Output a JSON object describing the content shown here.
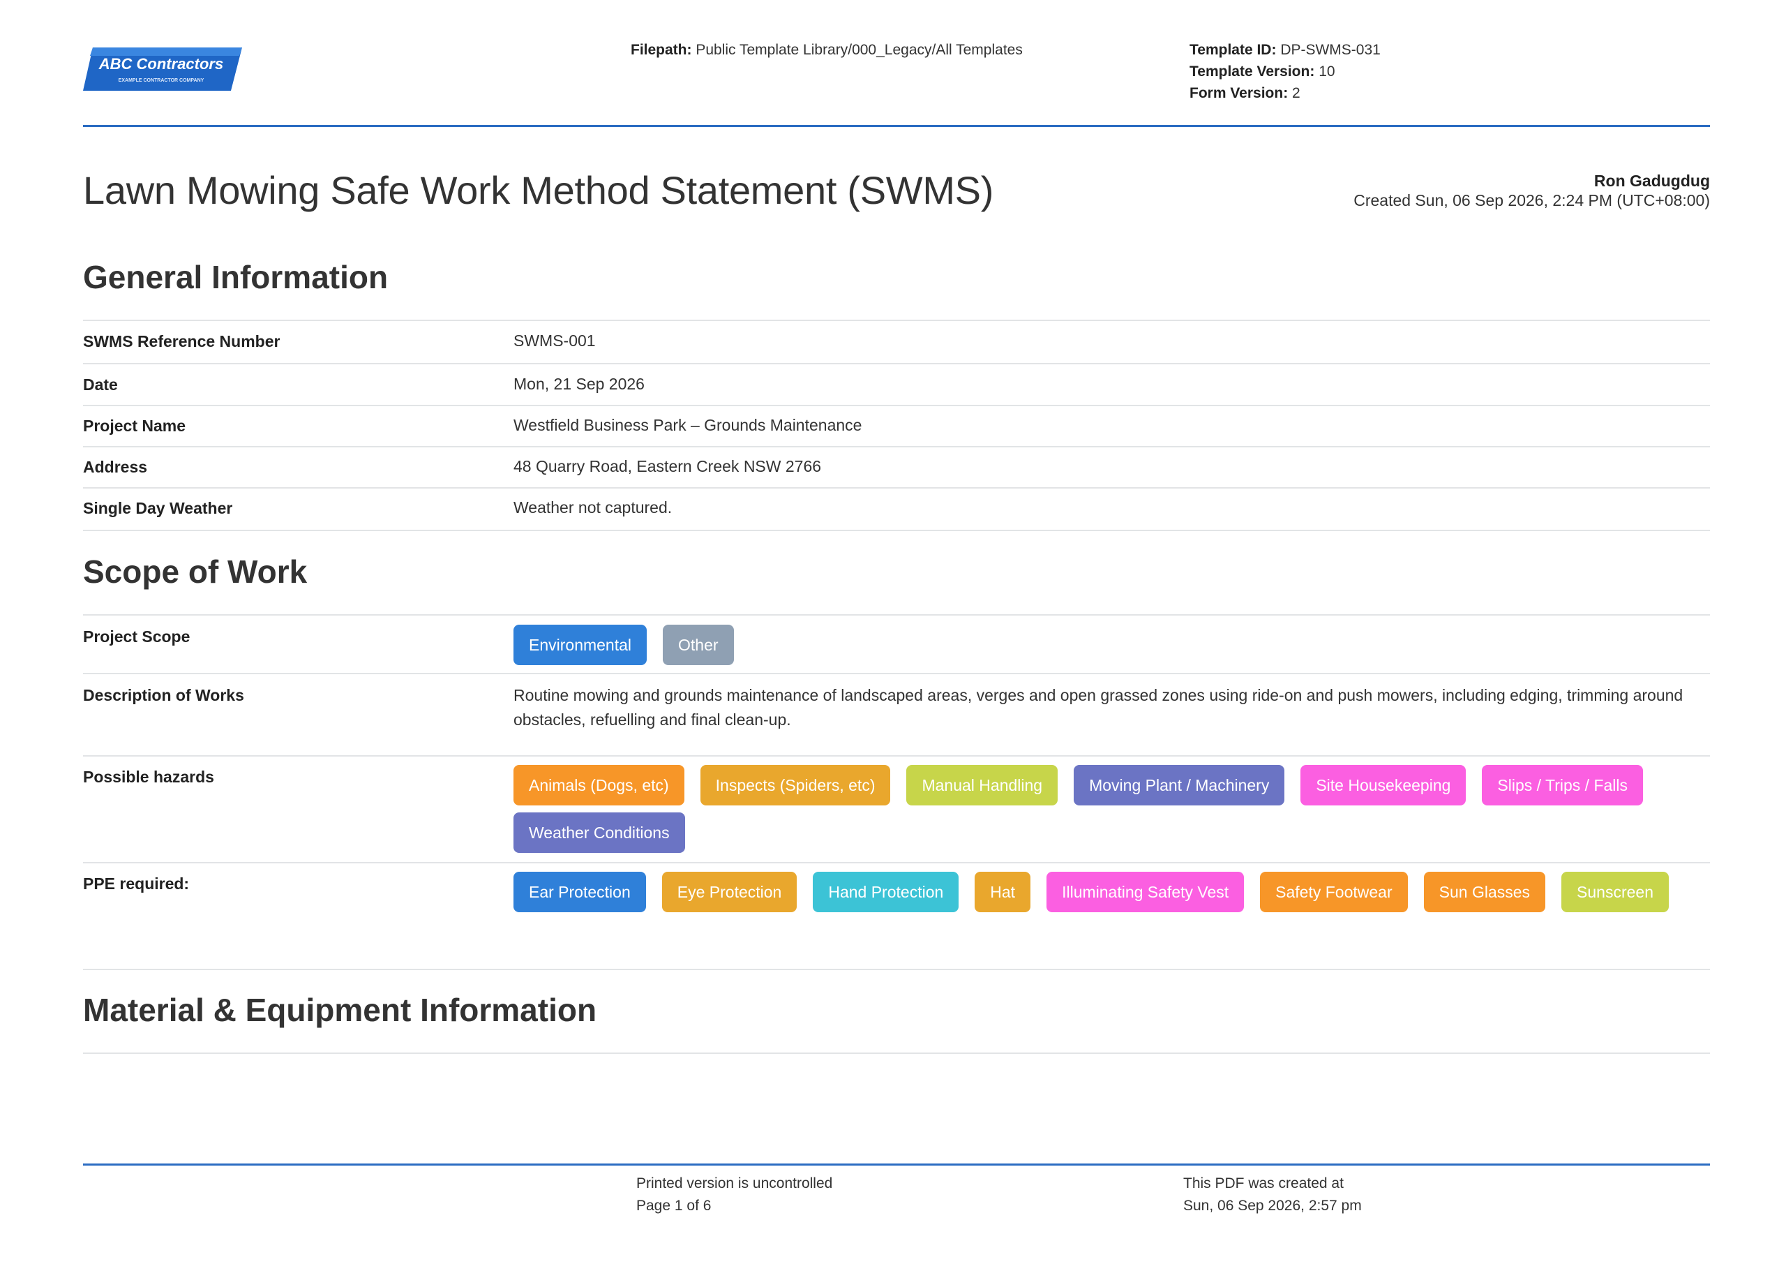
{
  "header": {
    "logo_text": "ABC Contractors",
    "logo_subtext": "EXAMPLE CONTRACTOR COMPANY",
    "filepath_label": "Filepath:",
    "filepath_value": "Public Template Library/000_Legacy/All Templates",
    "template_id_label": "Template ID:",
    "template_id_value": "DP-SWMS-031",
    "template_version_label": "Template Version:",
    "template_version_value": "10",
    "form_version_label": "Form Version:",
    "form_version_value": "2",
    "accent_color": "#2b6cc2"
  },
  "title": "Lawn Mowing Safe Work Method Statement (SWMS)",
  "author": {
    "name": "Ron Gadugdug",
    "created": "Created Sun, 06 Sep 2026, 2:24 PM (UTC+08:00)"
  },
  "general": {
    "heading": "General Information",
    "rows": [
      {
        "label": "SWMS Reference Number",
        "value": "SWMS-001"
      },
      {
        "label": "Date",
        "value": "Mon, 21 Sep 2026"
      },
      {
        "label": "Project Name",
        "value": "Westfield Business Park – Grounds Maintenance"
      },
      {
        "label": "Address",
        "value": "48 Quarry Road, Eastern Creek NSW 2766"
      },
      {
        "label": "Single Day Weather",
        "value": "Weather not captured."
      }
    ]
  },
  "scope": {
    "heading": "Scope of Work",
    "project_scope_label": "Project Scope",
    "project_scope": [
      {
        "text": "Environmental",
        "color": "#2f80d9"
      },
      {
        "text": "Other",
        "color": "#8fa0b3"
      }
    ],
    "description_label": "Description of Works",
    "description": "Routine mowing and grounds maintenance of landscaped areas, verges and open grassed zones using ride-on and push mowers, including edging, trimming around obstacles, refuelling and final clean-up.",
    "hazards_label": "Possible hazards",
    "hazards": [
      {
        "text": "Animals (Dogs, etc)",
        "color": "#f79628"
      },
      {
        "text": "Inspects (Spiders, etc)",
        "color": "#e9a72d"
      },
      {
        "text": "Manual Handling",
        "color": "#c7d54a"
      },
      {
        "text": "Moving Plant / Machinery",
        "color": "#6b74c4"
      },
      {
        "text": "Site Housekeeping",
        "color": "#fb5fe1"
      },
      {
        "text": "Slips / Trips / Falls",
        "color": "#fb5fe1"
      },
      {
        "text": "Weather Conditions",
        "color": "#6b74c4"
      }
    ],
    "ppe_label": "PPE required:",
    "ppe": [
      {
        "text": "Ear Protection",
        "color": "#2f80d9"
      },
      {
        "text": "Eye Protection",
        "color": "#e9a72d"
      },
      {
        "text": "Hand Protection",
        "color": "#3cc3d6"
      },
      {
        "text": "Hat",
        "color": "#e9a72d"
      },
      {
        "text": "Illuminating Safety Vest",
        "color": "#fb5fe1"
      },
      {
        "text": "Safety Footwear",
        "color": "#f79628"
      },
      {
        "text": "Sun Glasses",
        "color": "#f79628"
      },
      {
        "text": "Sunscreen",
        "color": "#c7d54a"
      }
    ]
  },
  "materials": {
    "heading": "Material & Equipment Information"
  },
  "footer": {
    "uncontrolled": "Printed version is uncontrolled",
    "page": "Page 1 of 6",
    "created_label": "This PDF was created at",
    "created_value": "Sun, 06 Sep 2026, 2:57 pm"
  }
}
